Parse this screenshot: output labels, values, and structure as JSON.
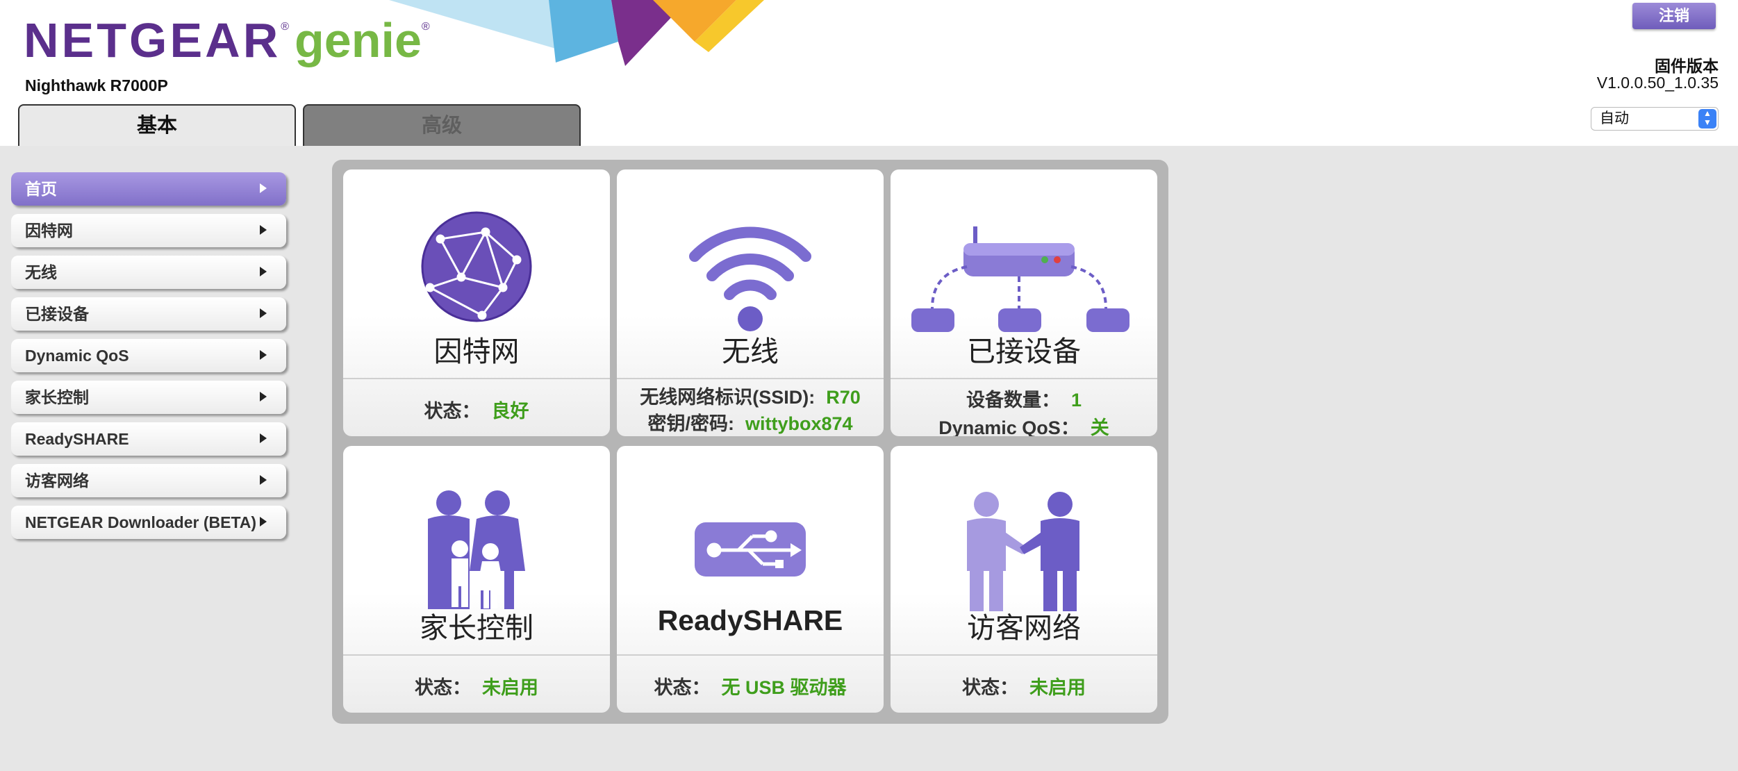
{
  "header": {
    "brand": "NETGEAR",
    "brand_reg": "®",
    "product": "genie",
    "product_reg": "®",
    "model": "Nighthawk R7000P",
    "logout_label": "注销",
    "firmware_label": "固件版本",
    "firmware_version": "V1.0.0.50_1.0.35",
    "language_selected": "自动"
  },
  "tabs": {
    "basic": "基本",
    "advanced": "高级"
  },
  "sidebar": {
    "items": [
      {
        "label": "首页"
      },
      {
        "label": "因特网"
      },
      {
        "label": "无线"
      },
      {
        "label": "已接设备"
      },
      {
        "label": "Dynamic QoS"
      },
      {
        "label": "家长控制"
      },
      {
        "label": "ReadySHARE"
      },
      {
        "label": "访客网络"
      },
      {
        "label": "NETGEAR Downloader (BETA)"
      }
    ]
  },
  "cards": {
    "internet": {
      "title": "因特网",
      "status_label": "状态：",
      "status_value": "良好"
    },
    "wireless": {
      "title": "无线",
      "ssid_label": "无线网络标识(SSID):",
      "ssid_value": "R70",
      "key_label": "密钥/密码:",
      "key_value": "wittybox874"
    },
    "devices": {
      "title": "已接设备",
      "count_label": "设备数量：",
      "count_value": "1",
      "qos_label": "Dynamic QoS：",
      "qos_value": "关"
    },
    "parental": {
      "title": "家长控制",
      "status_label": "状态：",
      "status_value": "未启用"
    },
    "readyshare": {
      "title": "ReadySHARE",
      "status_label": "状态：",
      "status_value": "无 USB 驱动器"
    },
    "guest": {
      "title": "访客网络",
      "status_label": "状态：",
      "status_value": "未启用"
    }
  },
  "colors": {
    "brand_purple": "#5b2f8c",
    "genie_green": "#77b845",
    "status_green": "#3f9e1c",
    "icon_purple": "#7b6cd0"
  },
  "icons": [
    "globe-icon",
    "wifi-icon",
    "router-icon",
    "family-icon",
    "usb-icon",
    "handshake-icon"
  ]
}
